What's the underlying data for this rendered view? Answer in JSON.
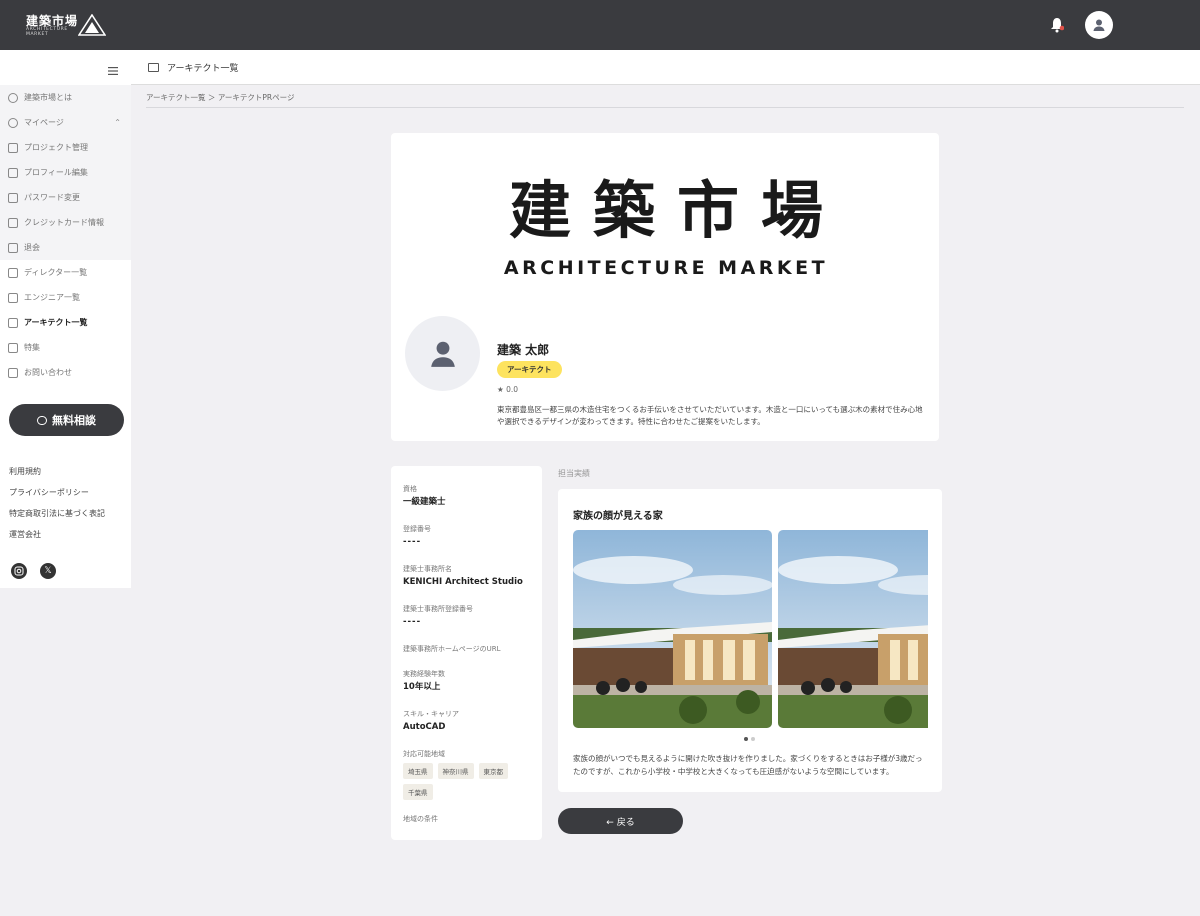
{
  "header": {
    "logo_kanji": "建築市場",
    "logo_sub": "ARCHITECTURE MARKET",
    "bell_icon": "bell-icon",
    "avatar_icon": "user-icon",
    "notify_color": "#e0524a"
  },
  "sidebar": {
    "items": [
      {
        "label": "建築市場とは",
        "icon": "home-icon",
        "bg": true
      },
      {
        "label": "マイページ",
        "icon": "user-circle-icon",
        "bg": true,
        "expandable": true
      },
      {
        "label": "プロジェクト管理",
        "icon": "sliders-icon",
        "bg": true
      },
      {
        "label": "プロフィール編集",
        "icon": "profile-card-icon",
        "bg": true
      },
      {
        "label": "パスワード変更",
        "icon": "key-icon",
        "bg": true
      },
      {
        "label": "クレジットカード情報",
        "icon": "credit-card-icon",
        "bg": true
      },
      {
        "label": "退会",
        "icon": "exit-icon",
        "bg": true
      },
      {
        "label": "ディレクター一覧",
        "icon": "window-icon",
        "bg": false
      },
      {
        "label": "エンジニア一覧",
        "icon": "window-icon",
        "bg": false
      },
      {
        "label": "アーキテクト一覧",
        "icon": "window-icon",
        "bg": false,
        "active": true
      },
      {
        "label": "特集",
        "icon": "document-icon",
        "bg": false
      },
      {
        "label": "お問い合わせ",
        "icon": "mail-icon",
        "bg": false
      }
    ],
    "consult_label": "無料相談",
    "footer_links": [
      "利用規約",
      "プライバシーポリシー",
      "特定商取引法に基づく表記",
      "運営会社"
    ],
    "social": [
      "instagram-icon",
      "x-icon"
    ]
  },
  "page": {
    "title": "アーキテクト一覧",
    "breadcrumb": "アーキテクト一覧 ＞ アーキテクトPRページ"
  },
  "profile": {
    "brand_kanji": "建築市場",
    "brand_en": "ARCHITECTURE MARKET",
    "name": "建築 太郎",
    "role_badge": "アーキテクト",
    "badge_color": "#fde35f",
    "rating": "★ 0.0",
    "description": "東京都豊島区一都三県の木造住宅をつくるお手伝いをさせていただいています。木造と一口にいっても選ぶ木の素材で住み心地や選択できるデザインが変わってきます。特性に合わせたご提案をいたします。"
  },
  "info": {
    "fields": [
      {
        "label": "資格",
        "value": "一級建築士"
      },
      {
        "label": "登録番号",
        "value": "----"
      },
      {
        "label": "建築士事務所名",
        "value": "KENICHI Architect Studio"
      },
      {
        "label": "建築士事務所登録番号",
        "value": "----"
      },
      {
        "label": "建築事務所ホームページのURL",
        "value": ""
      },
      {
        "label": "実務経験年数",
        "value": "10年以上"
      },
      {
        "label": "スキル・キャリア",
        "value": "AutoCAD"
      }
    ],
    "areas_label": "対応可能地域",
    "areas": [
      "埼玉県",
      "神奈川県",
      "東京都",
      "千葉県"
    ],
    "conditions_label": "地域の条件"
  },
  "works": {
    "section_title": "担当実績",
    "title": "家族の顔が見える家",
    "slide_count": 2,
    "active_slide": 1,
    "description": "家族の顔がいつでも見えるように開けた吹き抜けを作りました。家づくりをするときはお子様が3歳だったのですが、これから小学校・中学校と大きくなっても圧迫感がないような空間にしています。"
  },
  "back_button": "← 戻る"
}
